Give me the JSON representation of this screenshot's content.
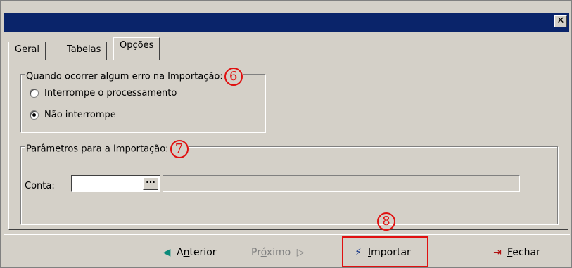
{
  "window": {
    "close_label": "✕"
  },
  "tabs": [
    {
      "label": "Geral"
    },
    {
      "label": "Tabelas"
    },
    {
      "label": "Opções"
    }
  ],
  "group_error": {
    "legend": "Quando ocorrer algum erro na Importação:",
    "marker": "6",
    "options": [
      {
        "label": "Interrompe o processamento",
        "checked": false
      },
      {
        "label": "Não interrompe",
        "checked": true
      }
    ]
  },
  "group_params": {
    "legend": "Parâmetros para a Importação:",
    "marker": "7",
    "conta_label": "Conta:",
    "conta_value": "",
    "ellipsis_label": "···",
    "description_value": ""
  },
  "footer": {
    "marker": "8",
    "prev": {
      "pre": "A",
      "ul": "n",
      "post": "terior",
      "icon": "◀"
    },
    "next": {
      "pre": "Pr",
      "ul": "ó",
      "post": "ximo",
      "icon": "▷"
    },
    "import": {
      "pre": "",
      "ul": "I",
      "post": "mportar",
      "icon": "⚡"
    },
    "close": {
      "pre": "",
      "ul": "F",
      "post": "echar",
      "icon": "⇥"
    }
  },
  "colors": {
    "titlebar": "#0a246a",
    "annotation_red": "#e01010",
    "face": "#d4d0c8"
  }
}
